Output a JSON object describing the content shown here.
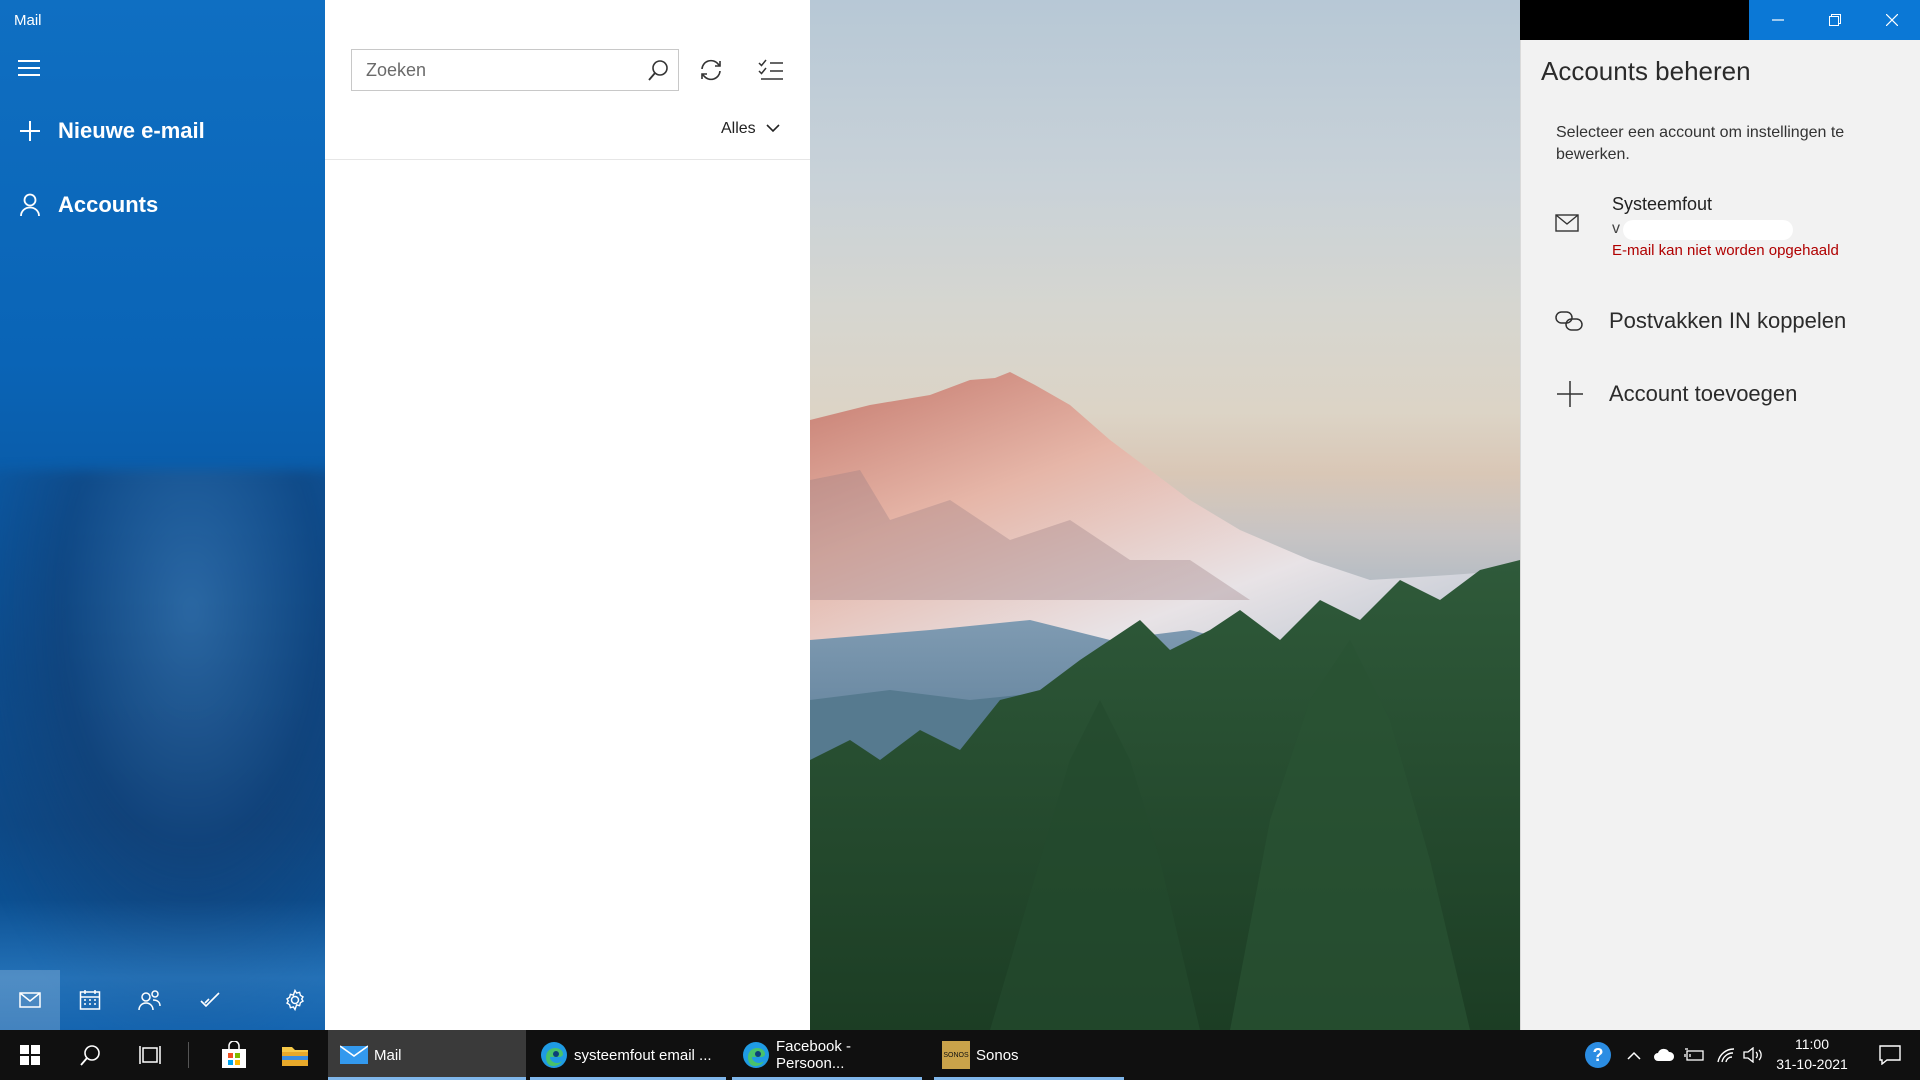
{
  "app": {
    "title": "Mail"
  },
  "nav": {
    "new_mail": "Nieuwe e-mail",
    "accounts": "Accounts",
    "bottom_icons": [
      "mail-icon",
      "calendar-icon",
      "people-icon",
      "todo-icon",
      "settings-icon"
    ]
  },
  "list": {
    "search_placeholder": "Zoeken",
    "filter": "Alles"
  },
  "panel": {
    "title": "Accounts beheren",
    "description": "Selecteer een account om instellingen te bewerken.",
    "account": {
      "name": "Systeemfout",
      "address": "v",
      "error": "E-mail kan niet worden opgehaald"
    },
    "link_inboxes": "Postvakken IN koppelen",
    "add_account": "Account toevoegen"
  },
  "taskbar": {
    "apps": [
      {
        "label": "Mail",
        "active": true
      },
      {
        "label": "systeemfout email ..."
      },
      {
        "label": "Facebook - Persoon..."
      },
      {
        "label": "Sonos"
      }
    ],
    "sonos_logo_text": "SONOS",
    "help_icon_text": "?",
    "time": "11:00",
    "date": "31-10-2021"
  },
  "colors": {
    "accent": "#0b78d6",
    "error": "#b00000",
    "panel_bg": "#f2f2f2",
    "taskbar_bg": "#101010"
  }
}
